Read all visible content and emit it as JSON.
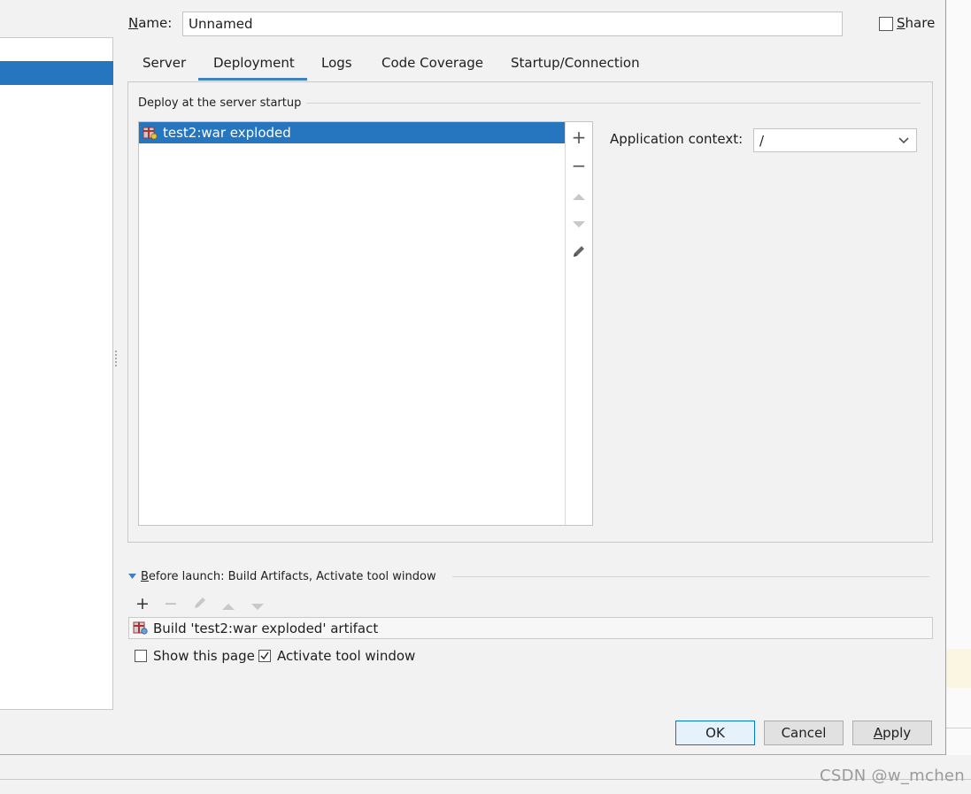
{
  "name": {
    "label_first": "N",
    "label_rest": "ame:",
    "value": "Unnamed"
  },
  "share": {
    "label_first": "S",
    "label_rest": "hare",
    "checked": false
  },
  "tabs": [
    {
      "label": "Server"
    },
    {
      "label": "Deployment",
      "active": true
    },
    {
      "label": "Logs"
    },
    {
      "label": "Code Coverage"
    },
    {
      "label": "Startup/Connection"
    }
  ],
  "deploy": {
    "title": "Deploy at the server startup",
    "items": [
      {
        "label": "test2:war exploded",
        "selected": true
      }
    ],
    "toolbar": {
      "add": "+",
      "remove": "−"
    }
  },
  "context": {
    "label": "Application context:",
    "value": "/"
  },
  "before_launch": {
    "title_first": "B",
    "title_rest": "efore launch: Build Artifacts, Activate tool window",
    "task": "Build 'test2:war exploded' artifact",
    "toolbar": {
      "add": "+",
      "remove": "−"
    }
  },
  "options": {
    "show_page": {
      "label": "Show this page",
      "checked": false
    },
    "activate_tool": {
      "label": "Activate tool window",
      "checked": true
    }
  },
  "buttons": {
    "ok": "OK",
    "cancel": "Cancel",
    "apply_first": "A",
    "apply_rest": "pply"
  },
  "watermark": "CSDN @w_mchen",
  "colors": {
    "selection": "#2675bf",
    "tab_underline": "#3f7fc6",
    "ok_border": "#0078d7"
  },
  "icons": [
    "artifact-icon",
    "plus-icon",
    "minus-icon",
    "arrow-up-icon",
    "arrow-down-icon",
    "pencil-icon",
    "chevron-down-icon",
    "triangle-expand-icon",
    "checkmark-icon"
  ]
}
